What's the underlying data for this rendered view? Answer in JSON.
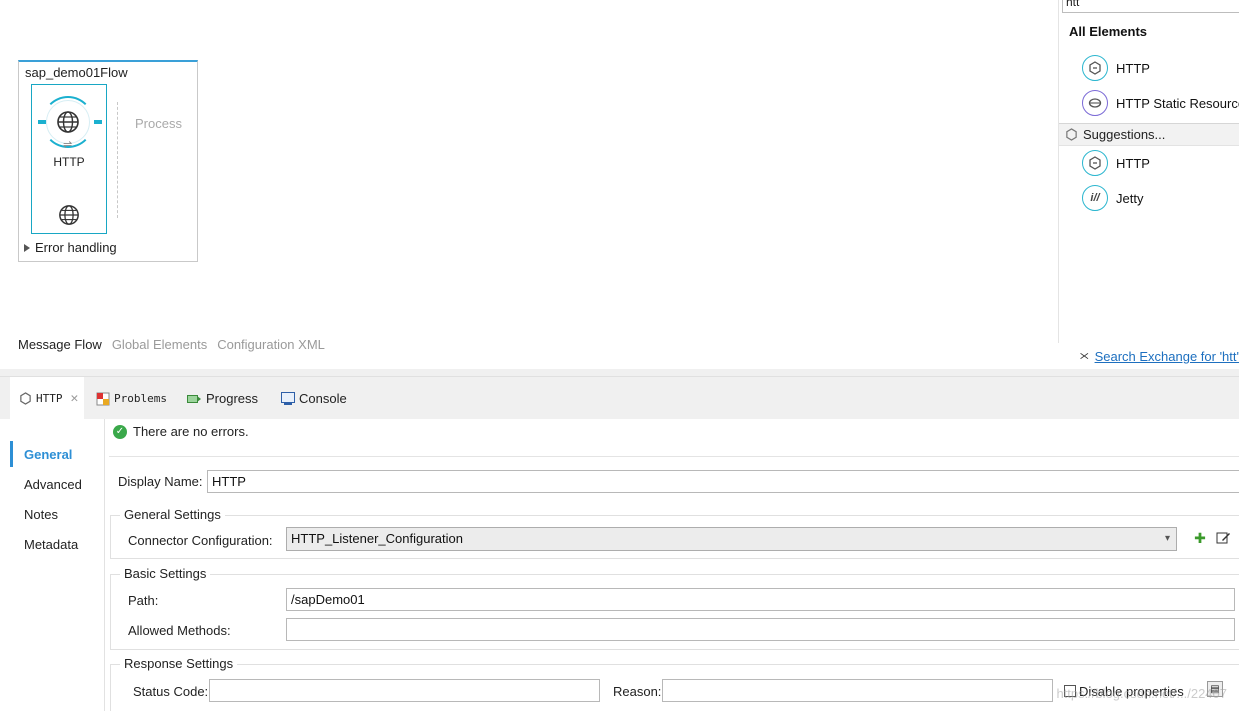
{
  "canvas": {
    "flow_title": "sap_demo01Flow",
    "source_label": "HTTP",
    "process_label": "Process",
    "error_handling": "Error handling",
    "editor_tabs": [
      {
        "label": "Message Flow",
        "active": true
      },
      {
        "label": "Global Elements",
        "active": false
      },
      {
        "label": "Configuration XML",
        "active": false
      }
    ]
  },
  "palette": {
    "search_value": "htt",
    "all_elements_heading": "All Elements",
    "all_elements": [
      {
        "label": "HTTP",
        "icon": "http-connector-icon"
      },
      {
        "label": "HTTP Static Resource",
        "icon": "http-static-resource-icon"
      }
    ],
    "suggestions_heading": "Suggestions...",
    "suggestions": [
      {
        "label": "HTTP",
        "icon": "http-connector-icon"
      },
      {
        "label": "Jetty",
        "icon": "jetty-icon"
      }
    ],
    "footer_link": "Search Exchange for 'htt'"
  },
  "view_tabs": [
    {
      "label": "HTTP",
      "icon": "http-connector-icon",
      "active": true
    },
    {
      "label": "Problems",
      "icon": "problems-icon",
      "active": false
    },
    {
      "label": "Progress",
      "icon": "progress-icon",
      "active": false
    },
    {
      "label": "Console",
      "icon": "console-icon",
      "active": false
    }
  ],
  "properties": {
    "nav": [
      {
        "label": "General",
        "active": true
      },
      {
        "label": "Advanced",
        "active": false
      },
      {
        "label": "Notes",
        "active": false
      },
      {
        "label": "Metadata",
        "active": false
      }
    ],
    "status_message": "There are no errors.",
    "display_name_label": "Display Name:",
    "display_name_value": "HTTP",
    "general_settings": {
      "title": "General Settings",
      "connector_config_label": "Connector Configuration:",
      "connector_config_value": "HTTP_Listener_Configuration"
    },
    "basic_settings": {
      "title": "Basic Settings",
      "path_label": "Path:",
      "path_value": "/sapDemo01",
      "allowed_methods_label": "Allowed Methods:",
      "allowed_methods_value": ""
    },
    "response_settings": {
      "title": "Response Settings",
      "status_code_label": "Status Code:",
      "status_code_value": "",
      "reason_label": "Reason:",
      "reason_value": "",
      "disable_properties_label": "Disable properties"
    }
  },
  "watermark": "https://blog.csdn.net/.../22407",
  "colors": {
    "accent_blue": "#2d8fd5",
    "connector_teal": "#1bb0cf",
    "success_green": "#3aa84a"
  }
}
